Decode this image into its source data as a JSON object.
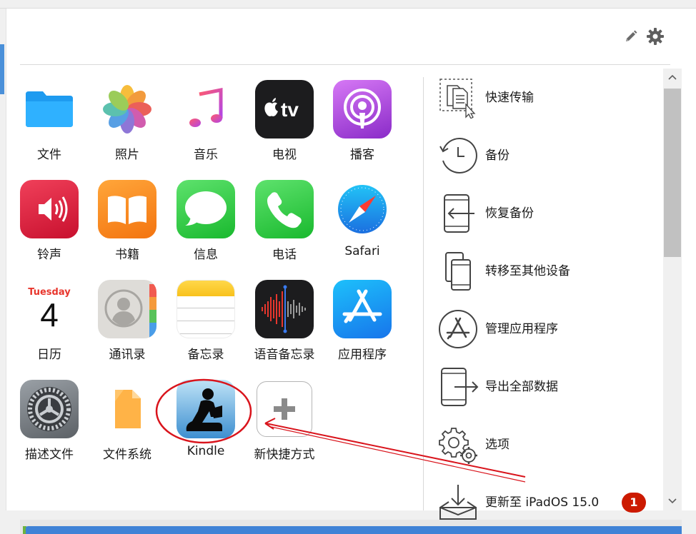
{
  "apps": [
    {
      "id": "files",
      "label": "文件"
    },
    {
      "id": "photos",
      "label": "照片"
    },
    {
      "id": "music",
      "label": "音乐"
    },
    {
      "id": "tv",
      "label": "电视",
      "icon_text": "tv"
    },
    {
      "id": "podcasts",
      "label": "播客"
    },
    {
      "id": "ringtones",
      "label": "铃声"
    },
    {
      "id": "books",
      "label": "书籍"
    },
    {
      "id": "messages",
      "label": "信息"
    },
    {
      "id": "phone",
      "label": "电话"
    },
    {
      "id": "safari",
      "label": "Safari"
    },
    {
      "id": "calendar",
      "label": "日历",
      "weekday": "Tuesday",
      "day": "4"
    },
    {
      "id": "contacts",
      "label": "通讯录"
    },
    {
      "id": "notes",
      "label": "备忘录"
    },
    {
      "id": "voice-memos",
      "label": "语音备忘录"
    },
    {
      "id": "app-store",
      "label": "应用程序"
    },
    {
      "id": "profiles",
      "label": "描述文件"
    },
    {
      "id": "file-system",
      "label": "文件系统"
    },
    {
      "id": "kindle",
      "label": "Kindle"
    },
    {
      "id": "new-shortcut",
      "label": "新快捷方式"
    }
  ],
  "actions": [
    {
      "id": "quick-transfer",
      "label": "快速传输"
    },
    {
      "id": "backup",
      "label": "备份"
    },
    {
      "id": "restore-backup",
      "label": "恢复备份"
    },
    {
      "id": "transfer-device",
      "label": "转移至其他设备"
    },
    {
      "id": "manage-apps",
      "label": "管理应用程序"
    },
    {
      "id": "export-all",
      "label": "导出全部数据"
    },
    {
      "id": "options",
      "label": "选项"
    },
    {
      "id": "update",
      "label": "更新至 iPadOS 15.0",
      "badge": "1"
    }
  ],
  "colors": {
    "accent": "#3f82d6",
    "badge": "#cc1a00",
    "annotation": "#d9141c",
    "icon_stroke": "#444444"
  },
  "icons": {
    "toolbar": [
      "pencil-icon",
      "gear-icon"
    ],
    "scroll": [
      "chevron-up-icon",
      "chevron-down-icon"
    ]
  }
}
